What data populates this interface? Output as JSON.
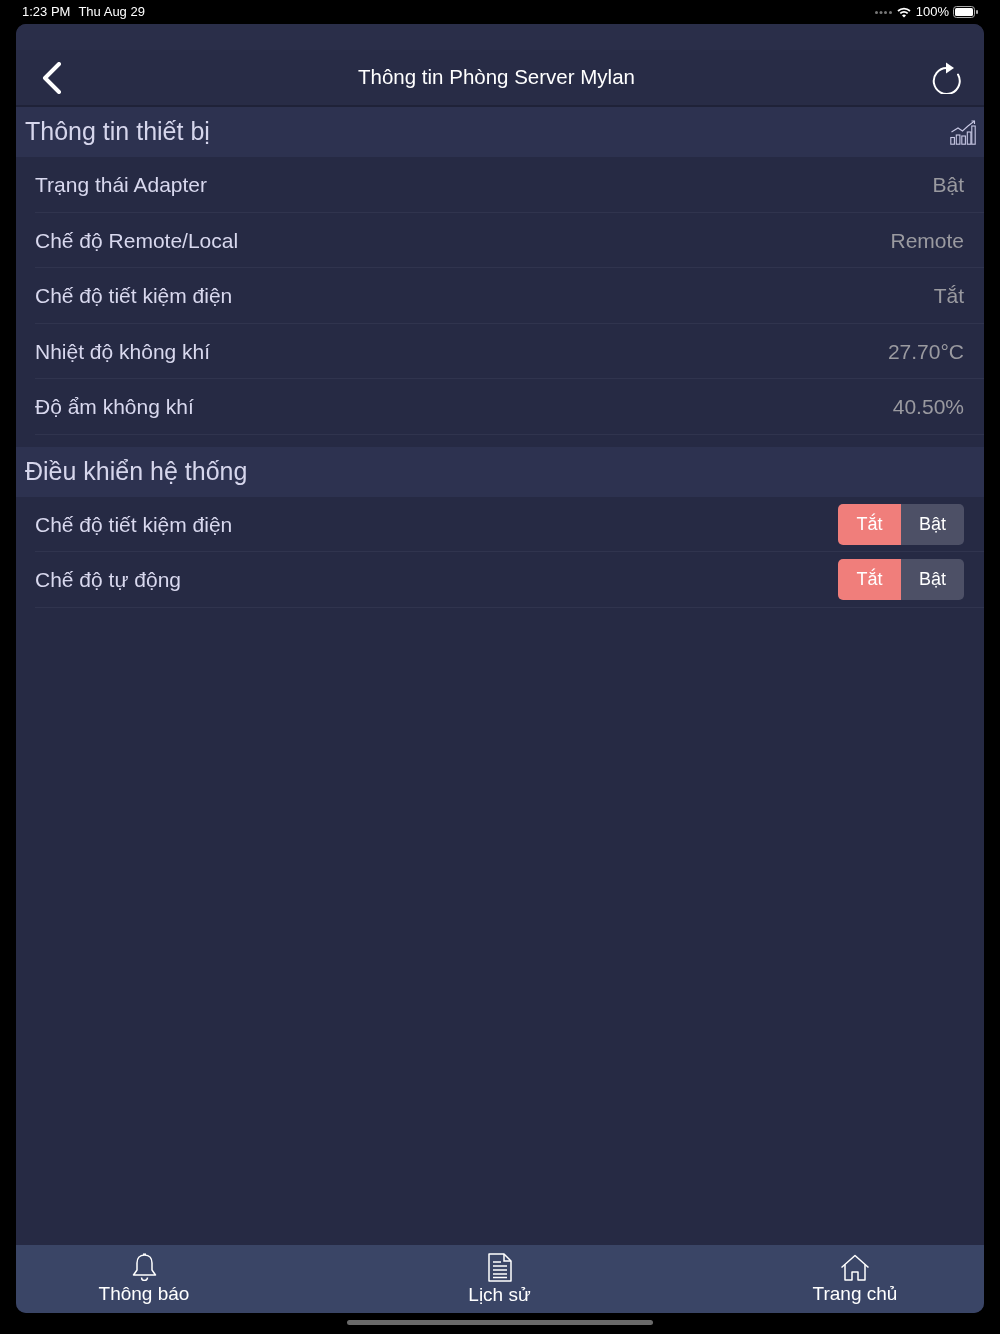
{
  "status_bar": {
    "time": "1:23 PM",
    "date": "Thu Aug 29",
    "battery": "100%"
  },
  "nav_bar": {
    "title": "Thông tin Phòng Server Mylan"
  },
  "sections": [
    {
      "title": "Thông tin thiết bị",
      "chart_button": true,
      "rows": [
        {
          "kind": "value",
          "label": "Trạng thái Adapter",
          "value": "Bật"
        },
        {
          "kind": "value",
          "label": "Chế độ Remote/Local",
          "value": "Remote"
        },
        {
          "kind": "value",
          "label": "Chế độ tiết kiệm điện",
          "value": "Tắt"
        },
        {
          "kind": "value",
          "label": "Nhiệt độ không khí",
          "value": "27.70°C"
        },
        {
          "kind": "value",
          "label": "Độ ẩm không khí",
          "value": "40.50%"
        }
      ]
    },
    {
      "title": "Điều khiển hệ thống",
      "chart_button": false,
      "rows": [
        {
          "kind": "toggle",
          "label": "Chế độ tiết kiệm điện",
          "options": [
            {
              "label": "Tắt",
              "selected": true
            },
            {
              "label": "Bật",
              "selected": false
            }
          ]
        },
        {
          "kind": "toggle",
          "label": "Chế độ tự động",
          "options": [
            {
              "label": "Tắt",
              "selected": true
            },
            {
              "label": "Bật",
              "selected": false
            }
          ]
        }
      ]
    }
  ],
  "tab_bar": {
    "items": [
      {
        "label": "Thông báo"
      },
      {
        "label": "Lịch sử"
      },
      {
        "label": "Trang chủ"
      }
    ]
  }
}
